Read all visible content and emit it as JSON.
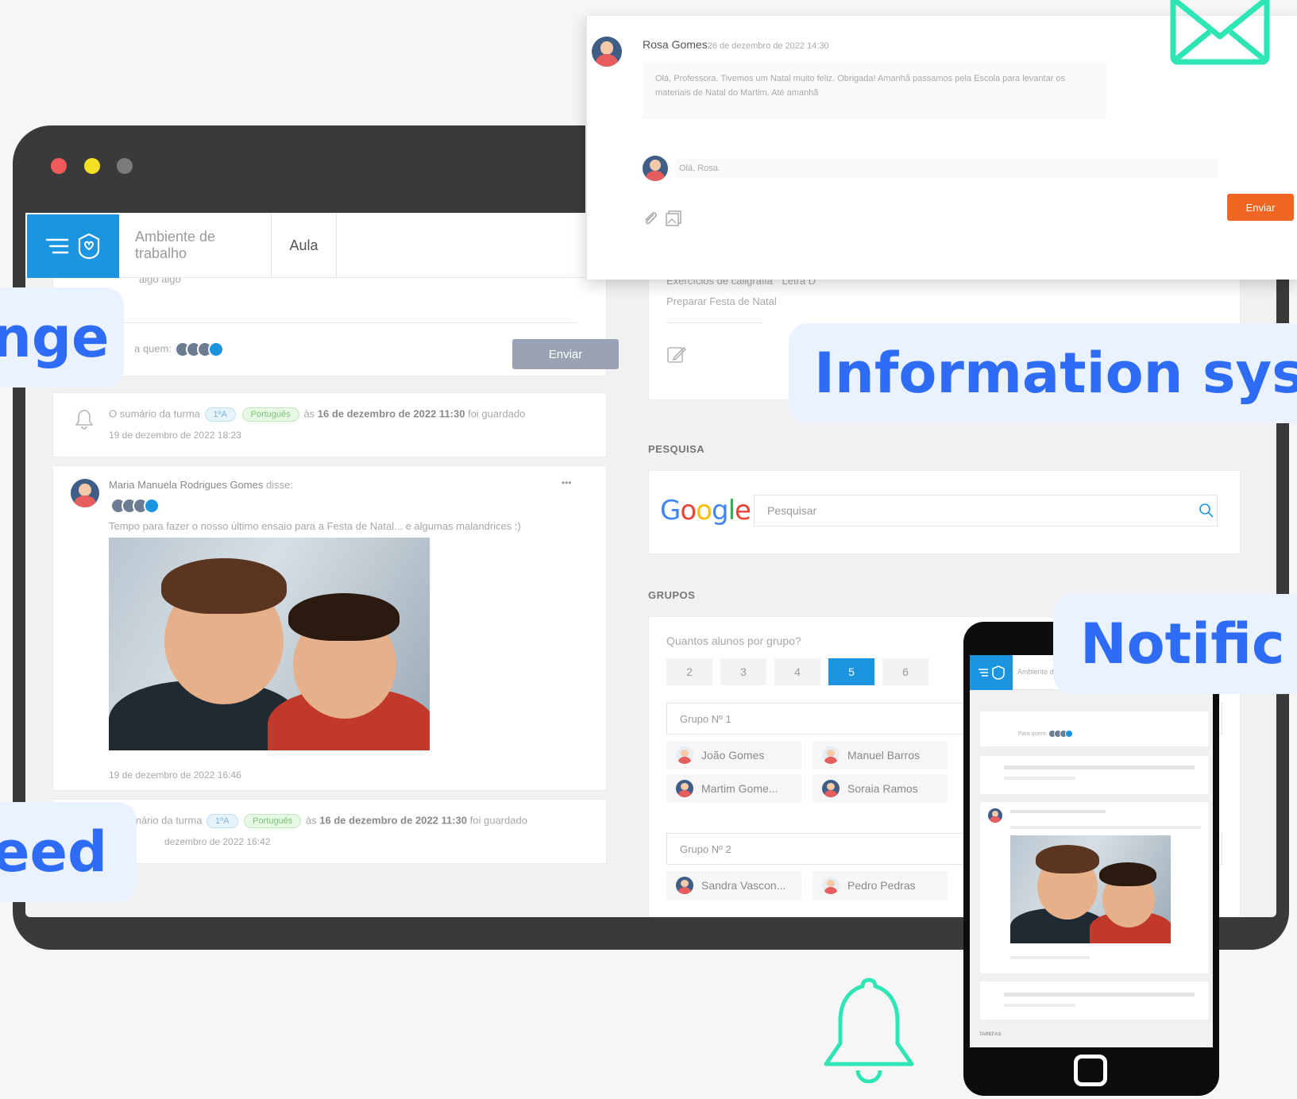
{
  "window_dots": [
    "#f15a5a",
    "#f5e023",
    "#7b7b7b"
  ],
  "topbar": {
    "tab_workspace": "Ambiente de trabalho",
    "tab_class": "Aula"
  },
  "composer": {
    "placeholder_partial": "algo algo",
    "audience_label": "a quem:",
    "send_label": "Enviar"
  },
  "feed": [
    {
      "type": "notice",
      "text_prefix": "O sumário da turma",
      "class_chip": "1ºA",
      "subject_chip": "Português",
      "text_middle": "às",
      "date_bold": "16 de dezembro de 2022 11:30",
      "text_suffix": "foi guardado",
      "timestamp": "19 de dezembro de 2022 18:23"
    },
    {
      "type": "post",
      "author": "Maria Manuela Rodrigues Gomes",
      "verb": "disse:",
      "more": "•••",
      "text": "Tempo para fazer o nosso último ensaio para a Festa de Natal... e algumas malandrices :)",
      "timestamp": "19 de dezembro de 2022 16:46"
    },
    {
      "type": "notice",
      "text_prefix": "mário da turma",
      "class_chip": "1ºA",
      "subject_chip": "Português",
      "text_middle": "às",
      "date_bold": "16 de dezembro de 2022 11:30",
      "text_suffix": "foi guardado",
      "timestamp": "dezembro de 2022 16:42"
    }
  ],
  "tasks": {
    "items": [
      "Exercícios de caligrafia \" Letra D\"",
      "Preparar Festa de Natal"
    ]
  },
  "search": {
    "section": "PESQUISA",
    "logo": "Google",
    "placeholder": "Pesquisar"
  },
  "groups": {
    "section": "GRUPOS",
    "question": "Quantos alunos por grupo?",
    "options": [
      "2",
      "3",
      "4",
      "5",
      "6"
    ],
    "selected": "5",
    "group1": {
      "title": "Grupo Nº 1",
      "members": [
        "João Gomes",
        "Manuel Barros",
        "Martim Gome...",
        "Soraia Ramos"
      ]
    },
    "group2": {
      "title": "Grupo Nº 2",
      "members": [
        "Sandra Vascon...",
        "Pedro Pedras"
      ]
    }
  },
  "message": {
    "author": "Rosa Gomes",
    "date": "26 de dezembro de 2022 14:30",
    "body": "Olá, Professora. Tivemos um Natal muito feliz. Obrigada! Amanhã passamos pela Escola para levantar os materiais de Natal do Martim. Até amanhã",
    "reply": "Olá, Rosa.",
    "send_label": "Enviar"
  },
  "labels": {
    "left_top": "nge",
    "left_bottom": "eed",
    "info": "Information sys",
    "notif": "Notific"
  },
  "phone": {
    "workspace": "Ambiente d",
    "audience": "Para quem:",
    "tasks_label": "TAREFAS"
  },
  "colors": {
    "brand_blue": "#1b95e0",
    "label_blue": "#2f6cf6",
    "label_bg": "#eaf1ff",
    "teal_icon": "#2ee6b4",
    "send_orange": "#f26522"
  },
  "icons": [
    "menu-icon",
    "app-logo-icon",
    "bell-icon",
    "edit-icon",
    "search-icon",
    "attach-icon",
    "image-icon",
    "mail-icon",
    "notification-bell-icon"
  ]
}
